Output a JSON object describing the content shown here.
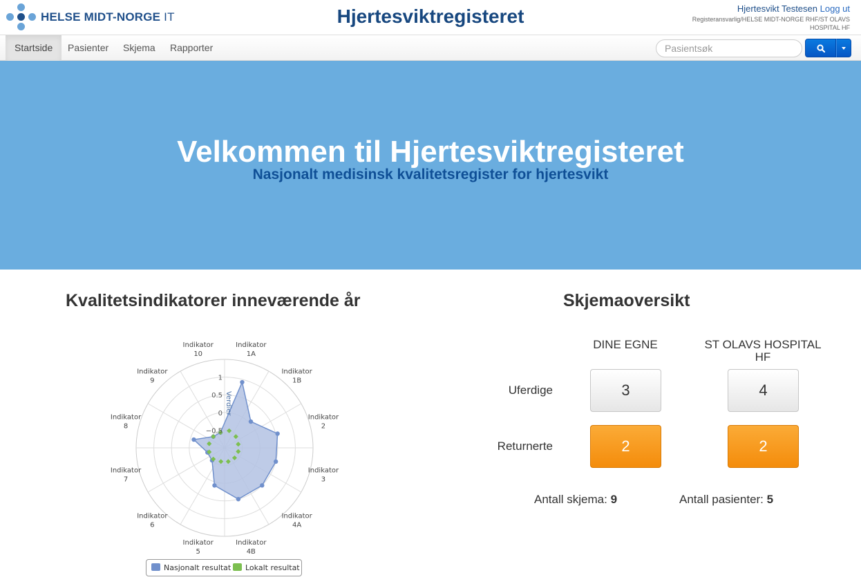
{
  "header": {
    "logo_bold": "HELSE MIDT-NORGE",
    "logo_light": " IT",
    "app_title": "Hjertesviktregisteret",
    "user_name": "Hjertesvikt Testesen",
    "logout_label": "Logg ut",
    "org_text": "Registeransvarlig/HELSE MIDT-NORGE RHF/ST OLAVS HOSPITAL HF"
  },
  "nav": {
    "items": [
      {
        "label": "Startside",
        "active": true
      },
      {
        "label": "Pasienter",
        "active": false
      },
      {
        "label": "Skjema",
        "active": false
      },
      {
        "label": "Rapporter",
        "active": false
      }
    ],
    "search_placeholder": "Pasientsøk",
    "search_icon": "search-icon",
    "button_color": "#0565cf"
  },
  "hero": {
    "title": "Velkommen til Hjertesviktregisteret",
    "subtitle": "Nasjonalt medisinsk kvalitetsregister for hjertesvikt",
    "background": "#6aaddf"
  },
  "quality": {
    "title": "Kvalitetsindikatorer inneværende år"
  },
  "chart_data": {
    "type": "radar",
    "categories": [
      [
        "Indikator",
        "1A"
      ],
      [
        "Indikator",
        "1B"
      ],
      [
        "Indikator",
        "2"
      ],
      [
        "Indikator",
        "3"
      ],
      [
        "Indikator",
        "4A"
      ],
      [
        "Indikator",
        "4B"
      ],
      [
        "Indikator",
        "5"
      ],
      [
        "Indikator",
        "6"
      ],
      [
        "Indikator",
        "7"
      ],
      [
        "Indikator",
        "8"
      ],
      [
        "Indikator",
        "9"
      ],
      [
        "Indikator",
        "10"
      ]
    ],
    "ylabel": "Verdier",
    "tick_labels": [
      "−0.5",
      "0",
      "0.5",
      "1"
    ],
    "ylim": [
      -1,
      1.5
    ],
    "grid": true,
    "legend_position": "bottom",
    "series": [
      {
        "name": "Nasjonalt resultat",
        "color": "#7090cc",
        "fill": "#b3c2e3",
        "values": [
          0.92,
          0.05,
          0.55,
          0.5,
          0.5,
          0.5,
          0.1,
          -0.5,
          -0.5,
          -0.1,
          -0.55,
          -0.55
        ]
      },
      {
        "name": "Lokalt resultat",
        "color": "#7cbf50",
        "values": [
          -0.5,
          -0.55,
          -0.6,
          -0.6,
          -0.6,
          -0.6,
          -0.6,
          -0.55,
          -0.55,
          -0.55,
          -0.55,
          -0.55
        ]
      }
    ]
  },
  "overview": {
    "title": "Skjemaoversikt",
    "columns": [
      "DINE EGNE",
      "ST OLAVS HOSPITAL HF"
    ],
    "rows": [
      {
        "label": "Uferdige",
        "values": [
          "3",
          "4"
        ]
      },
      {
        "label": "Returnerte",
        "values": [
          "2",
          "2"
        ]
      }
    ],
    "total_forms_label": "Antall skjema:",
    "total_forms": "9",
    "total_patients_label": "Antall pasienter:",
    "total_patients": "5",
    "orange": "#f59a1f"
  }
}
